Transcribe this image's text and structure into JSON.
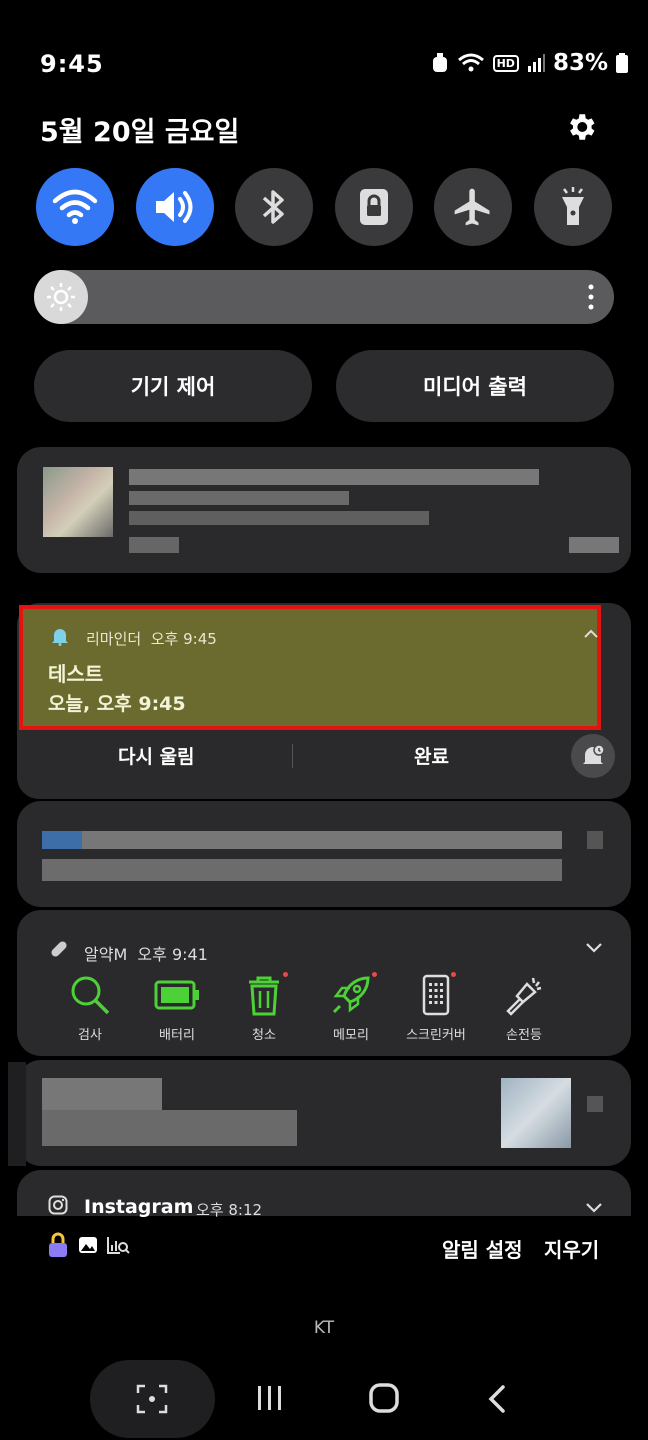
{
  "status_bar": {
    "time": "9:45",
    "battery": "83%",
    "network_badge": "HD"
  },
  "header": {
    "date": "5월 20일 금요일",
    "settings_icon": "gear-icon"
  },
  "quick_toggles": [
    {
      "name": "wifi",
      "icon": "wifi-icon",
      "on": true
    },
    {
      "name": "sound",
      "icon": "speaker-icon",
      "on": true
    },
    {
      "name": "bluetooth",
      "icon": "bluetooth-icon",
      "on": false
    },
    {
      "name": "rotation-lock",
      "icon": "lock-icon",
      "on": false
    },
    {
      "name": "airplane",
      "icon": "airplane-icon",
      "on": false
    },
    {
      "name": "flashlight",
      "icon": "flashlight-icon",
      "on": false
    }
  ],
  "brightness": {
    "level": 0.09
  },
  "buttons": {
    "device_control": "기기 제어",
    "media_output": "미디어 출력"
  },
  "reminder": {
    "app": "리마인더",
    "time": "오후 9:45",
    "title": "테스트",
    "body": "오늘, 오후 9:45",
    "snooze_label": "다시 울림",
    "done_label": "완료"
  },
  "almak": {
    "app": "알약M",
    "time": "오후 9:41",
    "tools": [
      {
        "label": "검사",
        "icon": "search-icon"
      },
      {
        "label": "배터리",
        "icon": "battery-icon"
      },
      {
        "label": "청소",
        "icon": "trash-icon"
      },
      {
        "label": "메모리",
        "icon": "rocket-icon"
      },
      {
        "label": "스크린커버",
        "icon": "screen-icon"
      },
      {
        "label": "손전등",
        "icon": "flashlight-icon"
      }
    ]
  },
  "instagram": {
    "app": "Instagram",
    "time": "오후 8:12"
  },
  "footer": {
    "notification_settings": "알림 설정",
    "clear": "지우기",
    "carrier": "KT"
  },
  "colors": {
    "accent": "#3478f6",
    "highlight_border": "#e4130f",
    "reminder_bg": "#6b6b2f",
    "tool_green": "#4cd137"
  }
}
